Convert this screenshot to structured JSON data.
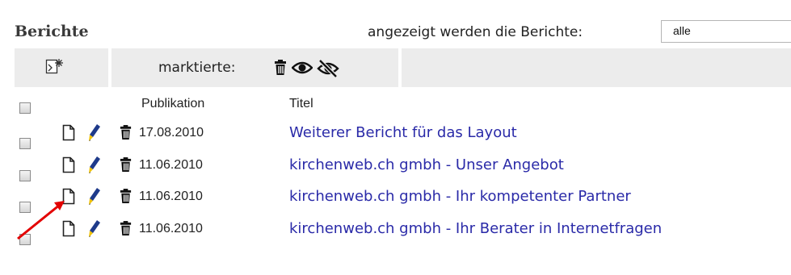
{
  "panel": {
    "title": "Berichte",
    "filter_label": "angezeigt werden die Berichte:",
    "filter_value": "alle"
  },
  "toolbar": {
    "marked_label": "marktierte:"
  },
  "table": {
    "columns": [
      "Publikation",
      "Titel"
    ],
    "rows": [
      {
        "date": "17.08.2010",
        "title": "Weiterer Bericht für das Layout"
      },
      {
        "date": "11.06.2010",
        "title": "kirchenweb.ch gmbh - Unser Angebot"
      },
      {
        "date": "11.06.2010",
        "title": "kirchenweb.ch gmbh - Ihr kompetenter Partner"
      },
      {
        "date": "11.06.2010",
        "title": "kirchenweb.ch gmbh - Ihr Berater in Internetfragen"
      }
    ]
  },
  "colors": {
    "link": "#2a2aa8",
    "toolbar_bg": "#ececec",
    "pencil": "#1e3a8a",
    "pencil_tip": "#f2c200",
    "annotation_arrow": "#e30000"
  },
  "icons": {
    "toolbar": [
      "select-all-icon",
      "delete-icon",
      "show-icon",
      "hide-icon"
    ],
    "row": [
      "document-icon",
      "edit-pencil-icon",
      "delete-icon"
    ]
  }
}
